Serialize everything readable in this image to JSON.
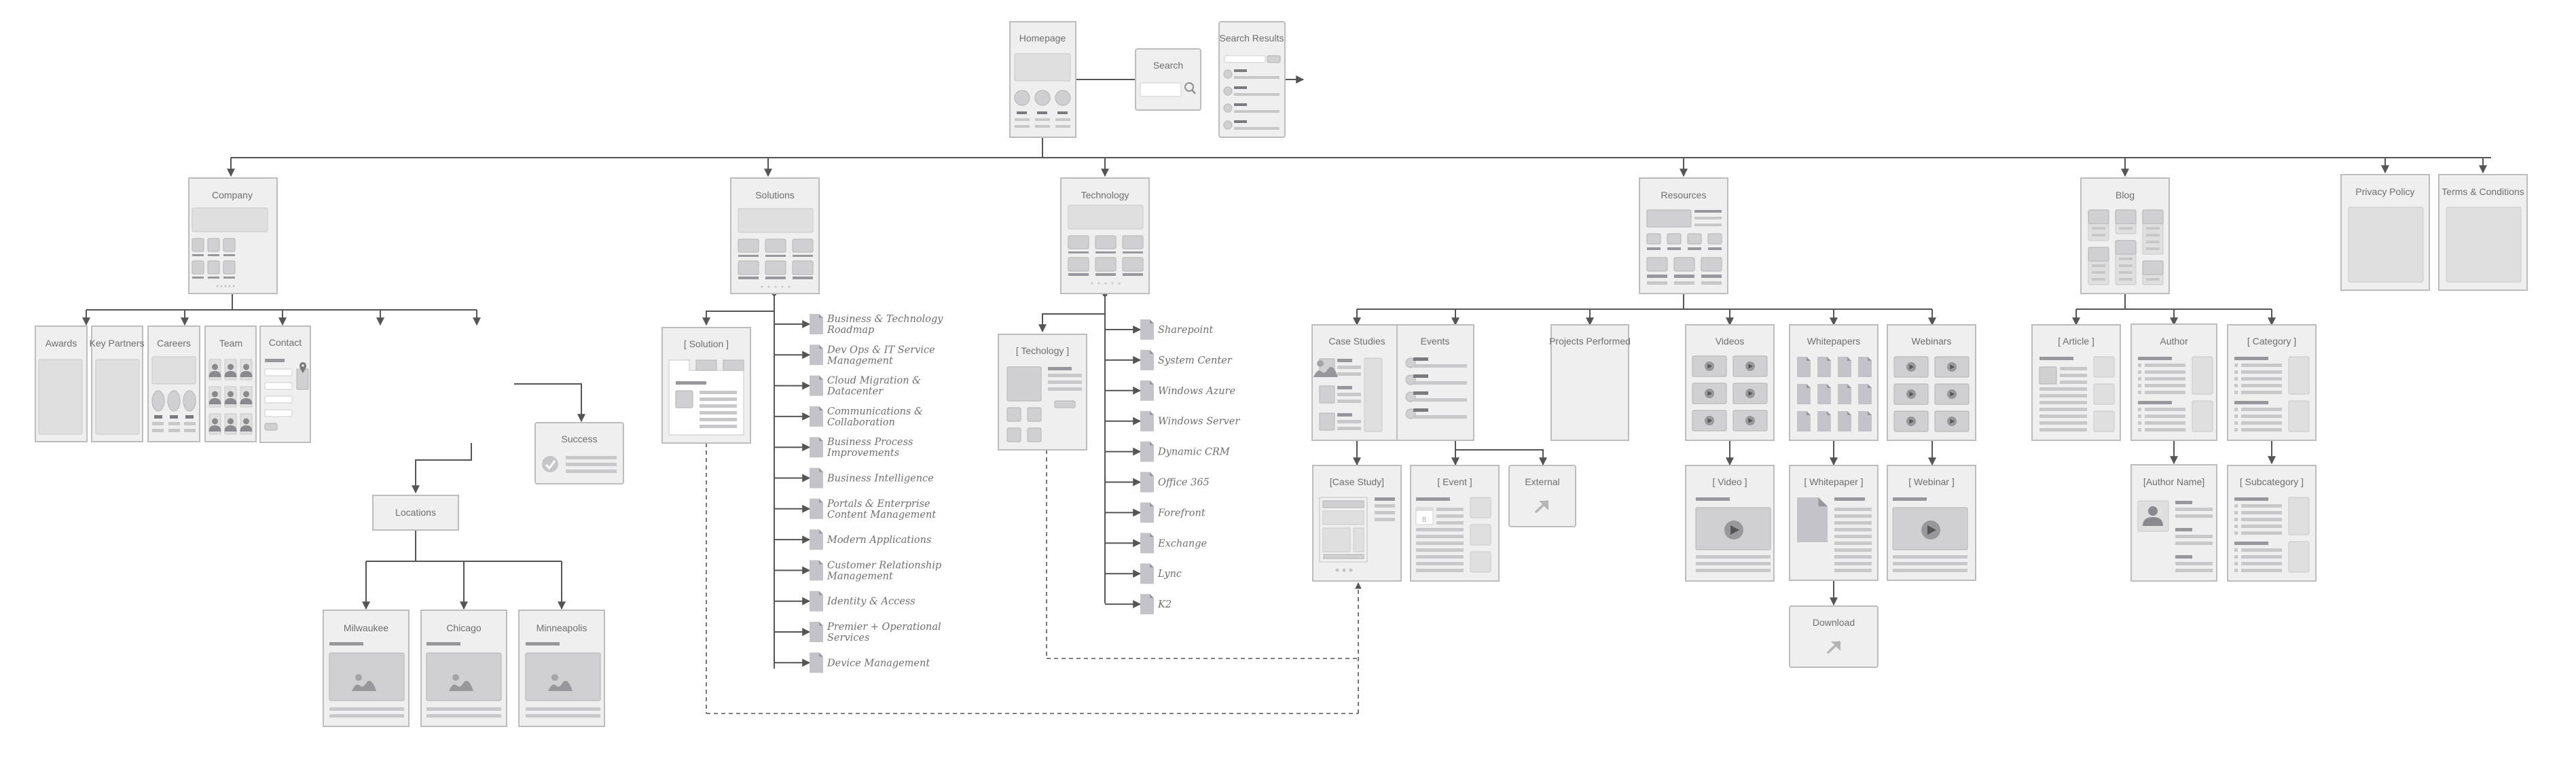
{
  "diagram": {
    "type": "website-sitemap-wireframe",
    "colors": {
      "page_fill": "#efefef",
      "page_border": "#bdbdbd",
      "connector": "#555555",
      "title_text": "#6e6e6e",
      "placeholder_dark": "#98979b",
      "placeholder_light": "#c8c8cb"
    },
    "top": {
      "homepage": "Homepage",
      "search": "Search",
      "search_results": "Search Results",
      "search_icon": "magnifier-icon"
    },
    "company": {
      "title": "Company",
      "children": {
        "awards": "Awards",
        "key_partners": "Key Partners",
        "careers": "Careers",
        "team": "Team",
        "contact": "Contact"
      },
      "contact_success": "Success",
      "locations": "Locations",
      "cities": [
        "Milwaukee",
        "Chicago",
        "Minneapolis"
      ]
    },
    "solutions": {
      "title": "Solutions",
      "detail": "[ Solution ]",
      "items": [
        [
          "Business & Technology",
          "Roadmap"
        ],
        [
          "Dev Ops & IT Service",
          "Management"
        ],
        [
          "Cloud Migration &",
          "Datacenter"
        ],
        [
          "Communications &",
          "Collaboration"
        ],
        [
          "Business Process",
          "Improvements"
        ],
        [
          "Business Intelligence"
        ],
        [
          "Portals & Enterprise",
          "Content Management"
        ],
        [
          "Modern Applications"
        ],
        [
          "Customer Relationship",
          "Management"
        ],
        [
          "Identity & Access"
        ],
        [
          "Premier + Operational",
          "Services"
        ],
        [
          "Device Management"
        ]
      ]
    },
    "technology": {
      "title": "Technology",
      "detail": "[ Techology ]",
      "items": [
        "Sharepoint",
        "System Center",
        "Windows Azure",
        "Windows Server",
        "Dynamic CRM",
        "Office 365",
        "Forefront",
        "Exchange",
        "Lync",
        "K2"
      ]
    },
    "resources": {
      "title": "Resources",
      "children": {
        "case_studies": "Case Studies",
        "events": "Events",
        "projects_performed": "Projects Performed",
        "videos": "Videos",
        "whitepapers": "Whitepapers",
        "webinars": "Webinars"
      },
      "case_study": "[Case Study]",
      "event": "[ Event ]",
      "event_date": "8",
      "external": "External",
      "video": "[ Video ]",
      "whitepaper": "[ Whitepaper ]",
      "webinar": "[ Webinar ]",
      "download": "Download"
    },
    "blog": {
      "title": "Blog",
      "article": "[ Article ]",
      "author": "Author",
      "category": "[ Category ]",
      "author_name": "[Author Name]",
      "subcategory": "[ Subcategory ]"
    },
    "legal": {
      "privacy_policy": "Privacy Policy",
      "terms": "Terms & Conditions"
    }
  }
}
